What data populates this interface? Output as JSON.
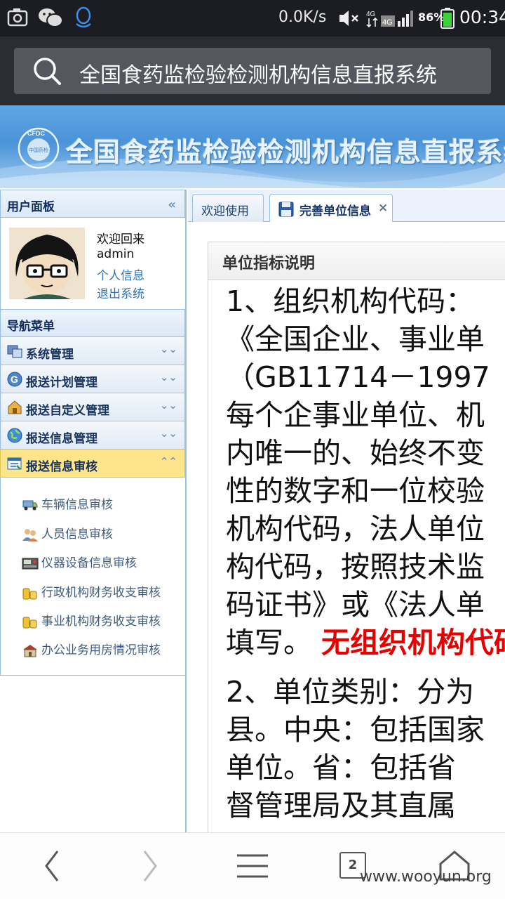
{
  "status_bar": {
    "net_speed": "0.0K/s",
    "network": "4G",
    "battery_pct": "86%",
    "time": "00:34"
  },
  "browser": {
    "url_text": "全国食药监检验检测机构信息直报系统",
    "tab_count": "2"
  },
  "banner": {
    "logo_text": "CFDC",
    "logo_sub": "中国药检",
    "title": "全国食药监检验检测机构信息直报系统"
  },
  "sidebar": {
    "user_panel_title": "用户面板",
    "welcome": "欢迎回来",
    "username": "admin",
    "profile_link": "个人信息",
    "logout_link": "退出系统",
    "nav_title": "导航菜单",
    "menu": [
      {
        "label": "系统管理",
        "icon": "system-icon"
      },
      {
        "label": "报送计划管理",
        "icon": "plan-icon"
      },
      {
        "label": "报送自定义管理",
        "icon": "house-icon"
      },
      {
        "label": "报送信息管理",
        "icon": "globe-icon"
      },
      {
        "label": "报送信息审核",
        "icon": "review-icon",
        "active": true
      }
    ],
    "submenu": [
      {
        "label": "车辆信息审核",
        "icon": "vehicle-icon"
      },
      {
        "label": "人员信息审核",
        "icon": "people-icon"
      },
      {
        "label": "仪器设备信息审核",
        "icon": "instrument-icon"
      },
      {
        "label": "行政机构财务收支审核",
        "icon": "coins-icon"
      },
      {
        "label": "事业机构财务收支审核",
        "icon": "coins-icon"
      },
      {
        "label": "办公业务用房情况审核",
        "icon": "building-icon"
      }
    ]
  },
  "tabs": [
    {
      "label": "欢迎使用"
    },
    {
      "label": "完善单位信息",
      "close": "×"
    }
  ],
  "doc": {
    "heading": "单位指标说明",
    "para1": [
      "1、组织机构代码：",
      "《全国企业、事业单",
      "（GB11714－1997",
      "每个企事业单位、机",
      "内唯一的、始终不变",
      "性的数字和一位校验",
      "机构代码，法人单位",
      "构代码，按照技术监",
      "码证书》或《法人单"
    ],
    "para1_last": "填写。",
    "para1_red": "无组织机构代码",
    "para2": [
      "2、单位类别：分为",
      "县。中央：包括国家",
      "单位。省：包括省",
      "督管理局及其直属"
    ]
  },
  "watermark": "www.wooyun.org"
}
